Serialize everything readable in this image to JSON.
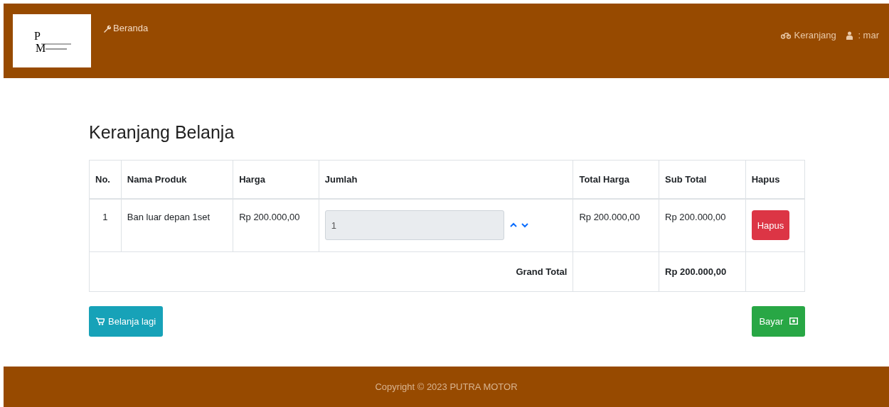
{
  "navbar": {
    "logo": {
      "letters": [
        "P",
        "M"
      ]
    },
    "home_link": "Beranda",
    "cart_link": "Keranjang",
    "user": ": mar"
  },
  "heading": "Keranjang Belanja",
  "table": {
    "columns": [
      "No.",
      "Nama Produk",
      "Harga",
      "Jumlah",
      "Total Harga",
      "Sub Total",
      "Hapus"
    ],
    "rows": [
      {
        "no": "1",
        "product": "Ban luar depan 1set",
        "price": "Rp 200.000,00",
        "quantity": "1",
        "total": "Rp 200.000,00",
        "subtotal": "Rp 200.000,00",
        "delete": "Hapus"
      }
    ],
    "grand_total_label": "Grand Total",
    "grand_total": "Rp 200.000,00"
  },
  "buttons": {
    "continue": "Belanja lagi",
    "pay": "Bayar"
  },
  "footer": "Copyright © 2023 PUTRA MOTOR"
}
